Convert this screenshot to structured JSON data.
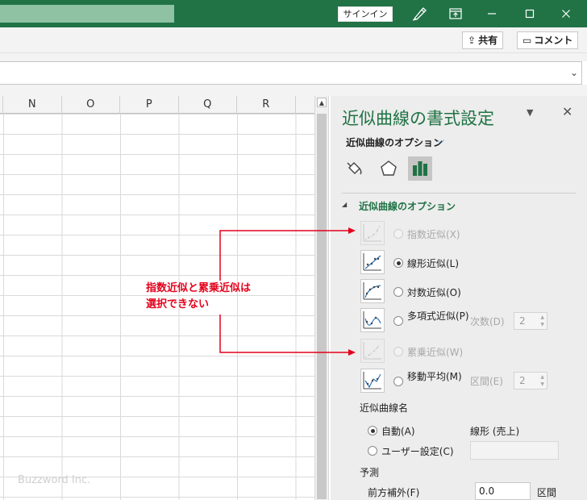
{
  "titlebar": {
    "signin_label": "サインイン",
    "accent": "#217346"
  },
  "ribbon": {
    "share_label": "共有",
    "comment_label": "コメント"
  },
  "grid": {
    "columns": [
      "N",
      "O",
      "P",
      "Q",
      "R"
    ]
  },
  "pane": {
    "title": "近似曲線の書式設定",
    "subtitle": "近似曲線のオプション",
    "section_title": "近似曲線のオプション",
    "options": {
      "exponential": "指数近似(X)",
      "linear": "線形近似(L)",
      "logarithmic": "対数近似(O)",
      "polynomial": "多項式近似(P)",
      "power": "累乗近似(W)",
      "moving_average": "移動平均(M)"
    },
    "order_label": "次数(D)",
    "order_value": "2",
    "period_label": "区間(E)",
    "period_value": "2",
    "name_section": "近似曲線名",
    "name_auto": "自動(A)",
    "name_auto_value": "線形 (売上)",
    "name_custom": "ユーザー設定(C)",
    "forecast_section": "予測",
    "forward_label": "前方補外(F)",
    "forward_value": "0.0",
    "forward_unit": "区間"
  },
  "callout": {
    "line1": "指数近似と累乗近似は",
    "line2": "選択できない",
    "color": "#e3001b"
  },
  "watermark": "Buzzword Inc."
}
